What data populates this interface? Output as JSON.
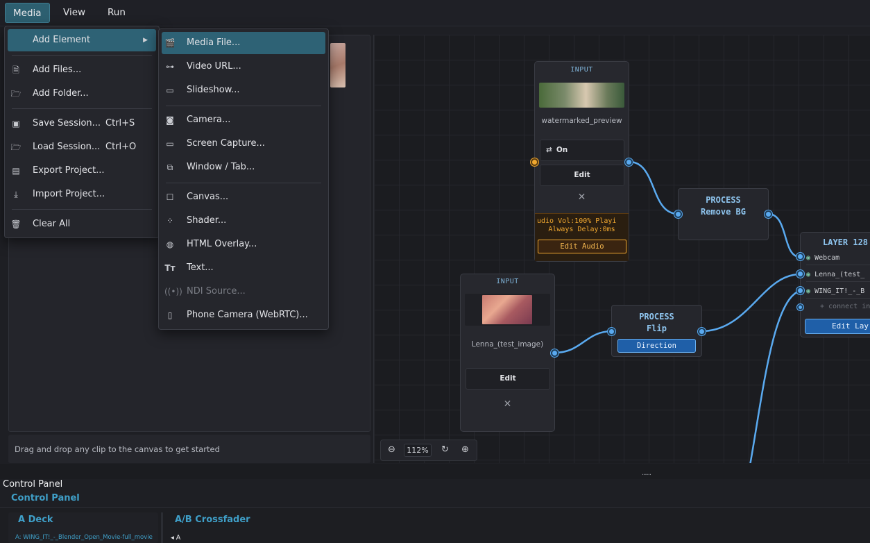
{
  "menubar": {
    "items": [
      {
        "label": "Media"
      },
      {
        "label": "View"
      },
      {
        "label": "Run"
      }
    ]
  },
  "media_menu": {
    "items": [
      {
        "label": "Add Element",
        "icon": "chevron-right-icon"
      },
      {
        "label": "Add Files...",
        "icon": "file-icon"
      },
      {
        "label": "Add Folder...",
        "icon": "folder-open-icon"
      },
      {
        "label": "Save Session...",
        "shortcut": "Ctrl+S",
        "icon": "save-icon"
      },
      {
        "label": "Load Session...",
        "shortcut": "Ctrl+O",
        "icon": "folder-open-icon"
      },
      {
        "label": "Export Project...",
        "icon": "archive-icon"
      },
      {
        "label": "Import Project...",
        "icon": "download-icon"
      },
      {
        "label": "Clear All",
        "icon": "trash-icon"
      }
    ]
  },
  "add_element_menu": {
    "items": [
      {
        "label": "Media File...",
        "icon": "clapperboard-icon"
      },
      {
        "label": "Video URL...",
        "icon": "link-icon"
      },
      {
        "label": "Slideshow...",
        "icon": "folder-icon"
      },
      {
        "label": "Camera...",
        "icon": "camera-icon"
      },
      {
        "label": "Screen Capture...",
        "icon": "monitor-icon"
      },
      {
        "label": "Window / Tab...",
        "icon": "window-icon"
      },
      {
        "label": "Canvas...",
        "icon": "square-icon"
      },
      {
        "label": "Shader...",
        "icon": "dots-grid-icon"
      },
      {
        "label": "HTML Overlay...",
        "icon": "globe-icon"
      },
      {
        "label": "Text...",
        "icon": "text-icon"
      },
      {
        "label": "NDI Source...",
        "icon": "broadcast-icon",
        "disabled": true
      },
      {
        "label": "Phone Camera (WebRTC)...",
        "icon": "phone-icon"
      }
    ]
  },
  "library": {
    "hint": "Drag and drop any clip to the canvas to get started"
  },
  "canvas": {
    "zoom": "112%",
    "nodes": {
      "input1": {
        "header": "INPUT",
        "name": "watermarked_preview",
        "toggle_label": "On",
        "edit_label": "Edit",
        "close": "✕",
        "audio_line1": "udio  Vol:100%  Playi",
        "audio_line2": "Always  Delay:0ms",
        "edit_audio_label": "Edit Audio"
      },
      "input2": {
        "header": "INPUT",
        "name": "Lenna_(test_image)",
        "edit_label": "Edit",
        "close": "✕"
      },
      "process_removebg": {
        "line1": "PROCESS",
        "line2": "Remove BG"
      },
      "process_flip": {
        "line1": "PROCESS",
        "line2": "Flip",
        "button": "Direction"
      },
      "layer": {
        "header": "LAYER  128",
        "rows": [
          "Webcam",
          "Lenna_(test_",
          "WING_IT!_-_B"
        ],
        "connect": "+ connect in",
        "edit_label": "Edit Lay"
      }
    }
  },
  "control_panel": {
    "title": "Control Panel",
    "subtitle": "Control Panel",
    "grip": "......",
    "deck_a": {
      "title": "A Deck",
      "source": "A: WING_IT!_-_Blender_Open_Movie-full_movie"
    },
    "crossfader": {
      "title": "A/B Crossfader",
      "side_a": "◂ A"
    }
  },
  "colors": {
    "accent": "#3f9fc8",
    "menu_highlight": "#2e6275",
    "port": "#5aaaf0",
    "audio_orange": "#f0a830"
  }
}
